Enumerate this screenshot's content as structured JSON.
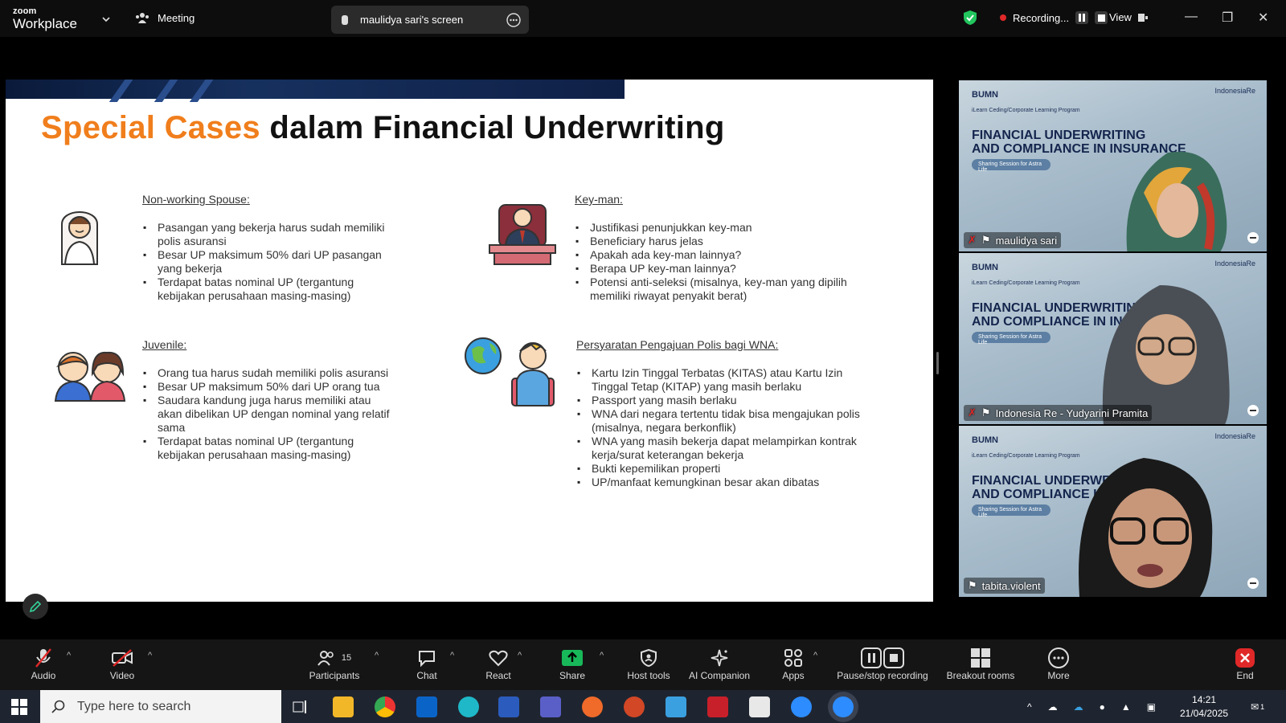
{
  "app": {
    "brand_top": "zoom",
    "brand_bottom": "Workplace",
    "meeting_label": "Meeting",
    "screen_label": "maulidya sari's screen",
    "recording_label": "Recording...",
    "view_label": "View"
  },
  "slide": {
    "title_accent": "Special Cases",
    "title_rest": " dalam Financial Underwriting",
    "sections": [
      {
        "heading": "Non-working Spouse:",
        "items": [
          "Pasangan yang bekerja harus sudah memiliki polis asuransi",
          "Besar UP maksimum 50% dari UP pasangan yang bekerja",
          "Terdapat batas nominal UP (tergantung kebijakan perusahaan masing-masing)"
        ]
      },
      {
        "heading": "Key-man:",
        "items": [
          "Justifikasi penunjukkan key-man",
          "Beneficiary harus jelas",
          "Apakah ada key-man lainnya?",
          "Berapa UP key-man lainnya?",
          "Potensi anti-seleksi (misalnya, key-man yang dipilih memiliki riwayat penyakit berat)"
        ]
      },
      {
        "heading": "Juvenile:",
        "items": [
          "Orang tua harus sudah memiliki polis asuransi",
          "Besar UP maksimum 50% dari UP orang tua",
          "Saudara kandung juga harus memiliki atau akan dibelikan UP dengan nominal yang relatif sama",
          "Terdapat batas nominal UP (tergantung kebijakan perusahaan masing-masing)"
        ]
      },
      {
        "heading": "Persyaratan Pengajuan Polis bagi WNA:",
        "items": [
          "Kartu Izin Tinggal Terbatas (KITAS) atau Kartu Izin Tinggal Tetap (KITAP) yang masih berlaku",
          "Passport yang masih berlaku",
          "WNA dari negara tertentu tidak bisa mengajukan polis (misalnya, negara berkonflik)",
          "WNA yang masih bekerja dapat melampirkan kontrak kerja/surat keterangan bekerja",
          "Bukti kepemilikan properti",
          "UP/manfaat kemungkinan besar akan dibatas"
        ]
      }
    ]
  },
  "participants": [
    {
      "name": "maulidya sari"
    },
    {
      "name": "Indonesia Re - Yudyarini Pramita"
    },
    {
      "name": "tabita.violent"
    }
  ],
  "tile_bg": {
    "logo": "BUMN",
    "logo_right": "IndonesiaRe",
    "small": "iLearn Ceding/Corporate Learning Program",
    "title_line1": "FINANCIAL UNDERWRITING",
    "title_line2": "AND COMPLIANCE IN INSURANCE",
    "pill": "Sharing Session for Astra Life"
  },
  "toolbar": {
    "audio": "Audio",
    "video": "Video",
    "participants": "Participants",
    "participants_count": "15",
    "chat": "Chat",
    "react": "React",
    "share": "Share",
    "host_tools": "Host tools",
    "ai_companion": "AI Companion",
    "apps": "Apps",
    "pause_stop": "Pause/stop recording",
    "breakout": "Breakout rooms",
    "more": "More",
    "end": "End"
  },
  "taskbar": {
    "search_placeholder": "Type here to search",
    "time": "14:21",
    "date": "21/04/2025",
    "notif_count": "1"
  },
  "colors": {
    "accent": "#f07e1c",
    "share_green": "#18b85a",
    "end_red": "#e02828",
    "active_tile": "#2fd680"
  }
}
